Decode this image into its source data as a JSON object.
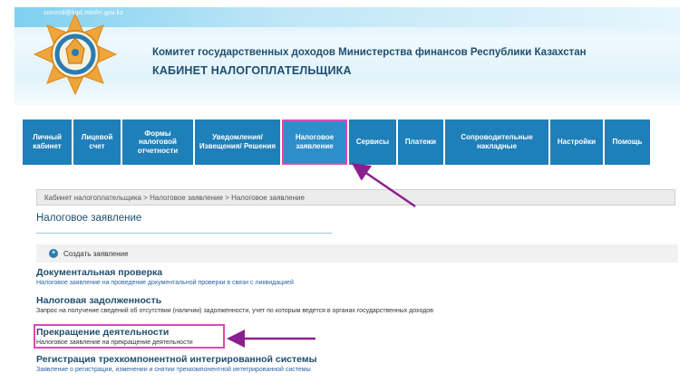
{
  "header": {
    "email": "sonosd@kgd.minfin.gov.kz",
    "organization": "Комитет государственных доходов Министерства финансов Республики Казахстан",
    "cabinet_title": "КАБИНЕТ НАЛОГОПЛАТЕЛЬЩИКА"
  },
  "nav": {
    "items": [
      {
        "label": "Личный кабинет"
      },
      {
        "label": "Лицевой счет"
      },
      {
        "label": "Формы налоговой отчетности"
      },
      {
        "label": "Уведомления/ Извещения/ Решения"
      },
      {
        "label": "Налоговое заявление",
        "active": true
      },
      {
        "label": "Сервисы"
      },
      {
        "label": "Платежи"
      },
      {
        "label": "Сопроводительные накладные"
      },
      {
        "label": "Настройки"
      },
      {
        "label": "Помощь"
      }
    ]
  },
  "breadcrumb": "Кабинет налогоплательщика > Налоговое заявление > Налоговое заявление",
  "page_title": "Налоговое заявление",
  "create_button": {
    "label": "Создать заявление",
    "icon": "plus-circle-icon"
  },
  "sections": [
    {
      "title": "Документальная проверка",
      "description": "Налоговое заявление на проведение документальной проверки в связи с ликвидацией"
    },
    {
      "title": "Налоговая задолженность",
      "description": "Запрос на получение сведений об отсутствии (наличии) задолженности, учет по которым ведется в органах государственных доходов"
    },
    {
      "title": "Прекращение деятельности",
      "description": "Налоговое заявление на прекращение деятельности"
    },
    {
      "title": "Регистрация трехкомпонентной интегрированной системы",
      "description": "Заявление о регистрации, изменении и снятии трехкомпонентной интегрированной системы"
    }
  ],
  "colors": {
    "nav": "#1f7fb8",
    "title": "#1f4e6e",
    "annotation": "#e247b3",
    "arrow": "#8b1f8f"
  }
}
